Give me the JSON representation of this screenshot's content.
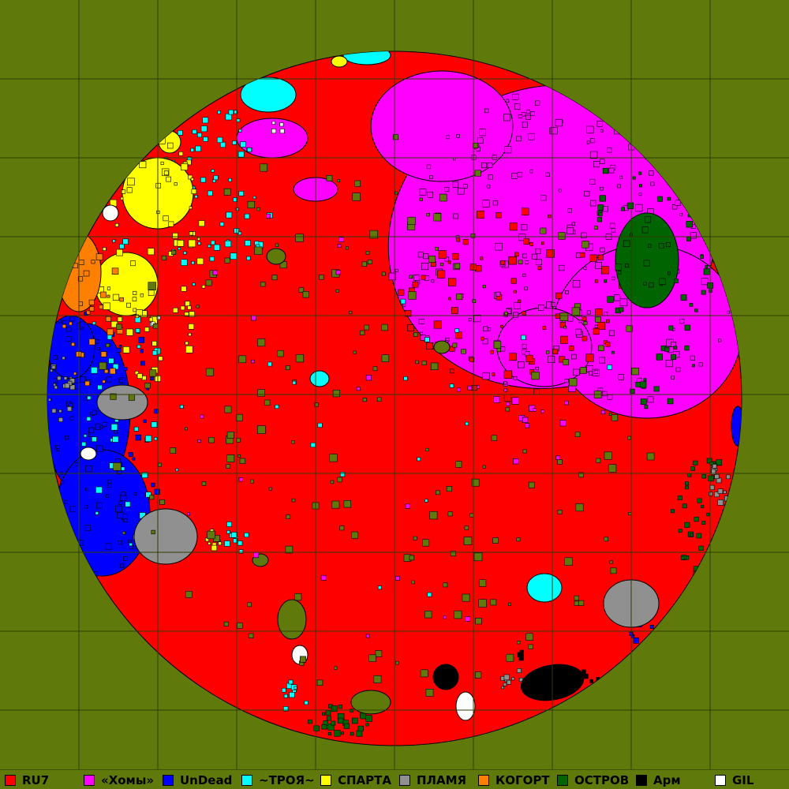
{
  "map": {
    "background_color": "#5f7a0a",
    "grid_color": "#2f3d05",
    "neutral_color": "#5f7a0a"
  },
  "legend": [
    {
      "label": "RU7",
      "color": "#ff0000"
    },
    {
      "label": "«Хомы»",
      "color": "#ff00ff"
    },
    {
      "label": "UnDead",
      "color": "#0000ff"
    },
    {
      "label": "~ТРОЯ~",
      "color": "#00ffff"
    },
    {
      "label": "СПАРТА",
      "color": "#ffff00"
    },
    {
      "label": "ПЛАМЯ",
      "color": "#909090"
    },
    {
      "label": "КОГОРТ",
      "color": "#ff8000"
    },
    {
      "label": "ОСТРОВ",
      "color": "#006400"
    },
    {
      "label": "Арм",
      "color": "#000000"
    },
    {
      "label": "GIL",
      "color": "#ffffff"
    }
  ]
}
